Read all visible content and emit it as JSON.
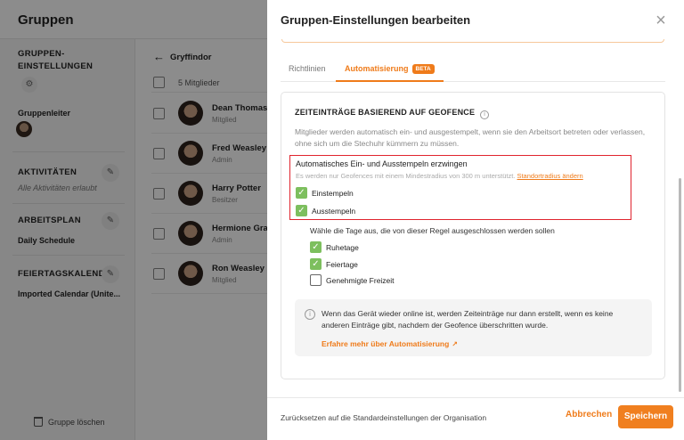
{
  "app": {
    "title": "Gruppen",
    "sidebar": {
      "settings_heading": "GRUPPEN-\nEINSTELLUNGEN",
      "leader_label": "Gruppenleiter",
      "activities_heading": "AKTIVITÄTEN",
      "activities_value": "Alle Aktivitäten erlaubt",
      "schedule_heading": "ARBEITSPLAN",
      "schedule_value": "Daily Schedule",
      "holiday_heading": "FEIERTAGSKALENDER",
      "holiday_value": "Imported Calendar (Unite...",
      "delete_label": "Gruppe löschen"
    },
    "team": {
      "name": "Gryffindor",
      "members_count": "5 Mitglieder",
      "members": [
        {
          "name": "Dean Thomas",
          "role": "Mitglied"
        },
        {
          "name": "Fred Weasley",
          "role": "Admin"
        },
        {
          "name": "Harry Potter",
          "role": "Besitzer"
        },
        {
          "name": "Hermione Gran",
          "role": "Admin"
        },
        {
          "name": "Ron Weasley",
          "role": "Mitglied"
        }
      ]
    }
  },
  "panel": {
    "title": "Gruppen-Einstellungen bearbeiten",
    "close_glyph": "×",
    "tabs": [
      {
        "label": "Richtlinien"
      },
      {
        "label": "Automatisierung",
        "badge": "BETA"
      }
    ],
    "geofence": {
      "title": "ZEITEINTRÄGE BASIEREND AUF GEOFENCE",
      "info_glyph": "i",
      "description": "Mitglieder werden automatisch ein- und ausgestempelt, wenn sie den Arbeitsort betreten oder verlassen, ohne sich um die Stechuhr kümmern zu müssen.",
      "enforce_title": "Automatisches Ein- und Ausstempeln erzwingen",
      "enforce_note": "Es werden nur Geofences mit einem Mindestradius von 300 m unterstützt.",
      "enforce_link": "Standortradius ändern",
      "options": [
        {
          "label": "Einstempeln",
          "checked": true
        },
        {
          "label": "Ausstempeln",
          "checked": true
        }
      ],
      "days_title": "Wähle die Tage aus, die von dieser Regel ausgeschlossen werden sollen",
      "days": [
        {
          "label": "Ruhetage",
          "checked": true
        },
        {
          "label": "Feiertage",
          "checked": true
        },
        {
          "label": "Genehmigte Freizeit",
          "checked": false
        }
      ],
      "info_text": "Wenn das Gerät wieder online ist, werden Zeiteinträge nur dann erstellt, wenn es keine anderen Einträge gibt, nachdem der Geofence überschritten wurde.",
      "learn_more": "Erfahre mehr über Automatisierung",
      "check_glyph": "✓",
      "ext_glyph": "↗"
    },
    "footer": {
      "reset": "Zurücksetzen auf die Standardeinstellungen der Organisation",
      "cancel": "Abbrechen",
      "save": "Speichern"
    }
  },
  "colors": {
    "accent": "#ef7b1a",
    "check": "#7dbf5e",
    "highlight": "#e0242e"
  }
}
